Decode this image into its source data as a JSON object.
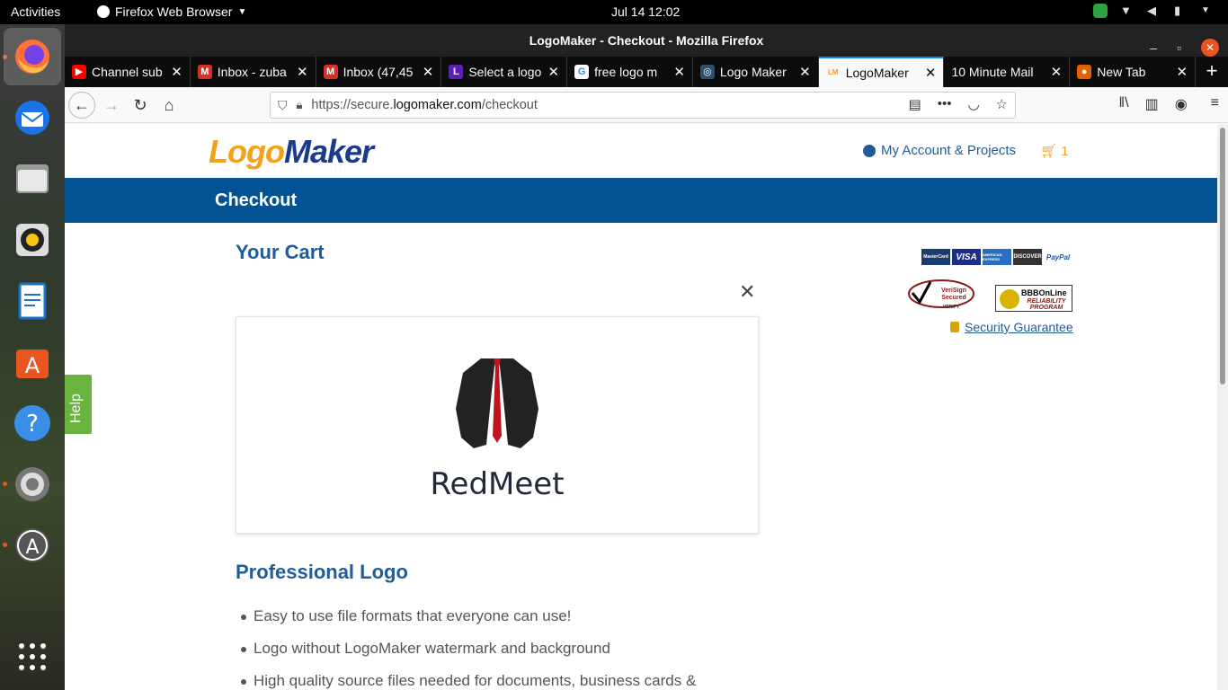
{
  "topbar": {
    "activities": "Activities",
    "app_menu": "Firefox Web Browser",
    "clock": "Jul 14  12:02"
  },
  "dock": {
    "items": [
      "firefox-icon",
      "thunderbird-icon",
      "files-icon",
      "rhythmbox-icon",
      "writer-icon",
      "software-icon",
      "help-icon",
      "settings-icon",
      "updater-icon",
      "apps-grid-icon"
    ]
  },
  "window": {
    "title": "LogoMaker - Checkout - Mozilla Firefox"
  },
  "tabs": [
    {
      "label": "Channel sub",
      "favicon": "youtube-icon",
      "color": "#ff0000",
      "glyph": "▶"
    },
    {
      "label": "Inbox - zuba",
      "favicon": "gmail-icon",
      "color": "#d93025",
      "glyph": "M"
    },
    {
      "label": "Inbox (47,45",
      "favicon": "gmail-icon",
      "color": "#d93025",
      "glyph": "M"
    },
    {
      "label": "Select a logo",
      "favicon": "l-icon",
      "color": "#5b21b6",
      "glyph": "L"
    },
    {
      "label": "free logo m",
      "favicon": "google-icon",
      "color": "#ffffff",
      "glyph": "G"
    },
    {
      "label": "Logo Maker",
      "favicon": "flo-icon",
      "color": "#2f4f6f",
      "glyph": "◎"
    },
    {
      "label": "LogoMaker",
      "favicon": "logomaker-icon",
      "color": "#f5a11a",
      "glyph": "LM"
    },
    {
      "label": "10 Minute Mail",
      "favicon": "",
      "color": "",
      "glyph": ""
    },
    {
      "label": "New Tab",
      "favicon": "firefox-icon",
      "color": "#e66000",
      "glyph": "●"
    }
  ],
  "navbar": {
    "url_prefix": "https://secure.",
    "url_domain": "logomaker.com",
    "url_path": "/checkout"
  },
  "site": {
    "logo_part1": "Logo",
    "logo_part2": "Maker",
    "account_link": "My Account & Projects",
    "cart_count": "1",
    "header_title": "Checkout"
  },
  "cart": {
    "heading": "Your Cart",
    "brand_name": "RedMeet",
    "product_title": "Professional Logo",
    "features": [
      "Easy to use file formats that everyone can use!",
      "Logo without LogoMaker watermark and background",
      "High quality source files needed for documents, business cards &"
    ]
  },
  "trust": {
    "payment_methods": [
      "MasterCard",
      "VISA",
      "AMERICAN EXPRESS",
      "DISCOVER",
      "PayPal"
    ],
    "verisign": "VeriSign Secured",
    "verisign_sub": "VERIFY",
    "bbb": "BBBOnLine",
    "bbb_sub": "RELIABILITY PROGRAM",
    "security_link": "Security Guarantee"
  },
  "help_tab": "Help"
}
